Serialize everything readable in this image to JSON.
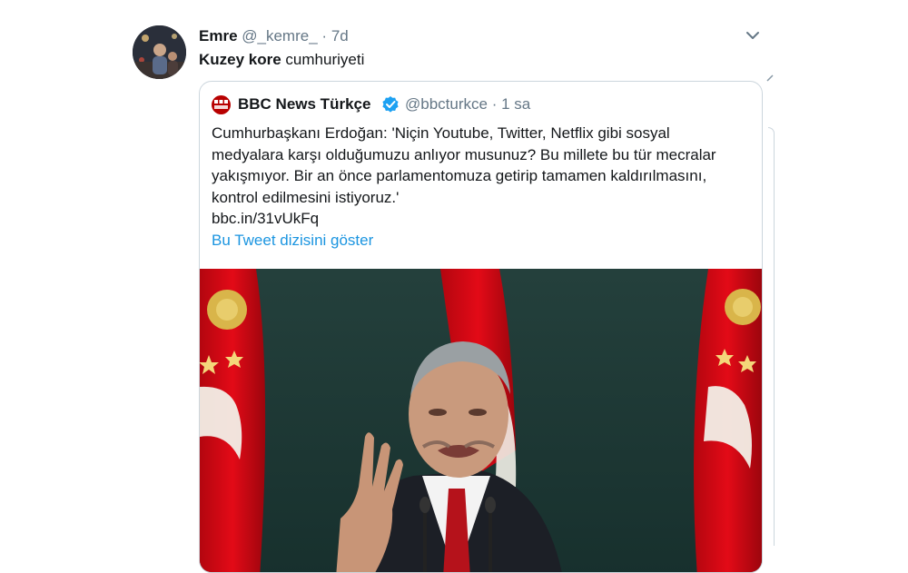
{
  "tweet": {
    "author_name": "Emre",
    "handle": "@_kemre_",
    "separator": "·",
    "time": "7d",
    "text_bold": "Kuzey kore",
    "text_rest": " cumhuriyeti",
    "avatar_icon": "user-photo-avatar",
    "menu_icon": "chevron-down-icon"
  },
  "quoted": {
    "logo_text": "BBC NEWS",
    "name": "BBC News Türkçe",
    "verified_icon": "verified-badge-icon",
    "handle": "@bbcturkce",
    "separator": "·",
    "time": "1 sa",
    "lines": [
      "Cumhurbaşkanı Erdoğan: 'Niçin Youtube, Twitter, Netflix gibi sosyal",
      "medyalara karşı olduğumuzu anlıyor musunuz? Bu millete bu tür mecralar",
      "yakışmıyor. Bir an önce parlamentomuza getirip tamamen kaldırılmasını,",
      "kontrol edilmesini istiyoruz.'",
      "bbc.in/31vUkFq"
    ],
    "show_thread": "Bu Tweet dizisini göster"
  },
  "colors": {
    "link": "#1b95e0",
    "secondary": "#657786",
    "flag_red": "#e30a17",
    "border": "#ccd6dd"
  }
}
